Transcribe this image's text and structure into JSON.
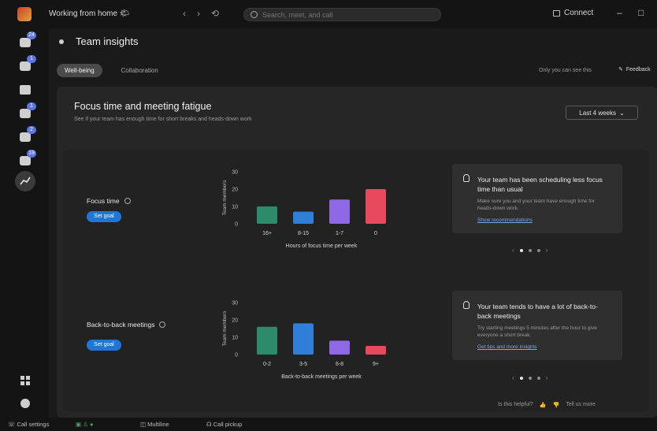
{
  "window": {
    "title": "Working from home 🌤",
    "search_placeholder": "Search, meet, and call",
    "connect_label": "Connect",
    "minimize": "–",
    "maximize": "□"
  },
  "rail": {
    "badges": [
      "24",
      "1",
      "",
      "1",
      "2",
      "19"
    ]
  },
  "page": {
    "title": "Team insights",
    "tabs": [
      "Well-being",
      "Collaboration"
    ],
    "active_tab": "Well-being",
    "visibility_note": "Only you can see this",
    "feedback_label": "Feedback"
  },
  "card": {
    "title": "Focus time and meeting fatigue",
    "subtitle": "See if your team has enough time for short breaks and heads-down work",
    "range_label": "Last 4 weeks",
    "metrics": [
      {
        "label": "Focus time",
        "goal_button": "Set goal",
        "insight_title": "Your team has been scheduling less focus time than usual",
        "insight_body": "Make sure you and your team have enough time for heads-down work.",
        "insight_link": "Show recommendations"
      },
      {
        "label": "Back-to-back meetings",
        "goal_button": "Set goal",
        "insight_title": "Your team tends to have a lot of back-to-back meetings",
        "insight_body": "Try starting meetings 5 minutes after the hour to give everyone a short break.",
        "insight_link": "Get tips and more insights"
      }
    ],
    "helpful_prompt": "Is this helpful?",
    "tell_us_more": "Tell us more"
  },
  "chart_data": [
    {
      "type": "bar",
      "ylabel": "Team members",
      "xlabel": "Hours of focus time per week",
      "categories": [
        "16+",
        "8-15",
        "1-7",
        "0"
      ],
      "values": [
        10,
        7,
        14,
        20
      ],
      "colors": [
        "#2e8b6a",
        "#2f7fd9",
        "#8f69e3",
        "#e8495c"
      ],
      "yticks": [
        0,
        10,
        20,
        30
      ],
      "ylim": [
        0,
        30
      ]
    },
    {
      "type": "bar",
      "ylabel": "Team members",
      "xlabel": "Back-to-back meetings per week",
      "categories": [
        "0-2",
        "3-5",
        "6-8",
        "9+"
      ],
      "values": [
        16,
        18,
        8,
        5
      ],
      "colors": [
        "#2e8b6a",
        "#2f7fd9",
        "#8f69e3",
        "#e8495c"
      ],
      "yticks": [
        0,
        10,
        20,
        30
      ],
      "ylim": [
        0,
        30
      ]
    }
  ],
  "statusbar": {
    "call_settings": "Call settings",
    "multiline": "Multiline",
    "call_pickup": "Call pickup"
  }
}
